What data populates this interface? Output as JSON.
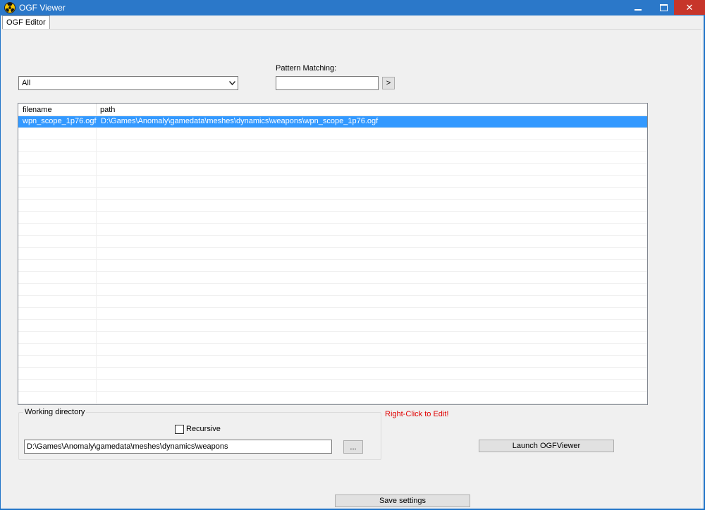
{
  "window": {
    "title": "OGF Viewer",
    "buttons": {
      "minimize": "▬",
      "maximize": "☐",
      "close": "✕"
    }
  },
  "tabs": [
    {
      "label": "OGF Editor",
      "active": true
    }
  ],
  "filter": {
    "combo_value": "All",
    "pattern_label": "Pattern Matching:",
    "pattern_value": "",
    "go_label": ">"
  },
  "list": {
    "columns": [
      "filename",
      "path"
    ],
    "rows": [
      {
        "filename": "wpn_scope_1p76.ogf",
        "path": "D:\\Games\\Anomaly\\gamedata\\meshes\\dynamics\\weapons\\wpn_scope_1p76.ogf",
        "selected": true
      }
    ]
  },
  "working_directory": {
    "group_title": "Working directory",
    "recursive_label": "Recursive",
    "recursive_checked": false,
    "path": "D:\\Games\\Anomaly\\gamedata\\meshes\\dynamics\\weapons",
    "browse_label": "..."
  },
  "hint_text": "Right-Click to Edit!",
  "launch_label": "Launch OGFViewer",
  "save_label": "Save settings",
  "colors": {
    "selection": "#3399ff",
    "titlebar": "#2b78c9",
    "close": "#c7352a",
    "hint": "#e00000"
  }
}
